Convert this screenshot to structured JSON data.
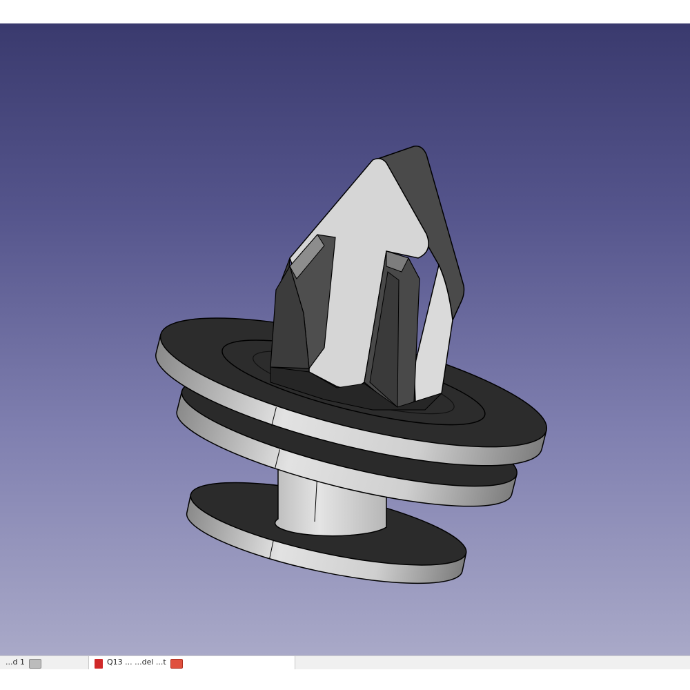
{
  "viewport": {
    "model": "push-rivet-clip",
    "colors": {
      "background_top": "#3a3a6e",
      "background_bottom": "#a9a9c8",
      "face_light": "#d0d0d0",
      "face_dark": "#2e2e2e",
      "edge": "#000000"
    }
  },
  "tabs": [
    {
      "label": "...d 1",
      "icon": "close-icon",
      "active": false
    },
    {
      "label": "Q13 ...  ...del ...t",
      "icon": "document-icon",
      "active": true
    }
  ]
}
